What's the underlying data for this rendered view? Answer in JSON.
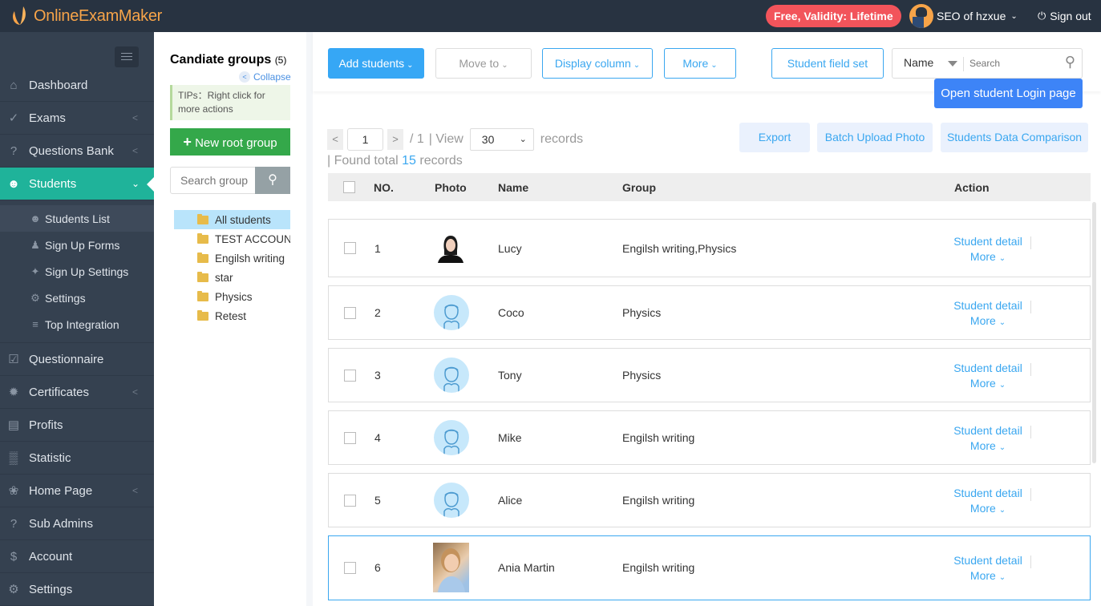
{
  "app": {
    "logo_text": "OnlineExamMaker",
    "validity_badge": "Free, Validity: Lifetime",
    "user_name": "SEO of hzxue",
    "sign_out": "Sign out"
  },
  "sidebar": {
    "items": [
      {
        "label": "Dashboard",
        "icon": "home-icon",
        "has_chevron": false
      },
      {
        "label": "Exams",
        "icon": "check-circle-icon",
        "has_chevron": true
      },
      {
        "label": "Questions Bank",
        "icon": "question-circle-icon",
        "has_chevron": true
      },
      {
        "label": "Students",
        "icon": "users-icon",
        "has_chevron": true,
        "active": true
      },
      {
        "label": "Questionnaire",
        "icon": "checkbox-icon",
        "has_chevron": false
      },
      {
        "label": "Certificates",
        "icon": "certificate-icon",
        "has_chevron": true
      },
      {
        "label": "Profits",
        "icon": "credit-card-icon",
        "has_chevron": false
      },
      {
        "label": "Statistic",
        "icon": "bar-chart-icon",
        "has_chevron": false
      },
      {
        "label": "Home Page",
        "icon": "leaf-icon",
        "has_chevron": true
      },
      {
        "label": "Sub Admins",
        "icon": "question-circle-icon",
        "has_chevron": false
      },
      {
        "label": "Account",
        "icon": "dollar-icon",
        "has_chevron": false
      },
      {
        "label": "Settings",
        "icon": "gear-icon",
        "has_chevron": false
      }
    ],
    "students_submenu": [
      {
        "label": "Students List",
        "icon": "users-icon",
        "active": true
      },
      {
        "label": "Sign Up Forms",
        "icon": "user-plus-icon"
      },
      {
        "label": "Sign Up Settings",
        "icon": "wrench-icon"
      },
      {
        "label": "Settings",
        "icon": "gear-icon"
      },
      {
        "label": "Top Integration",
        "icon": "ordered-list-icon"
      }
    ]
  },
  "groups": {
    "title": "Candiate groups",
    "count": "(5)",
    "collapse": "Collapse",
    "tips": "TIPs：Right click for more actions",
    "new_root_group": "New root group",
    "search_placeholder": "Search group",
    "tree": [
      {
        "label": "All students",
        "active": true
      },
      {
        "label": "TEST ACCOUNT"
      },
      {
        "label": "Engilsh writing"
      },
      {
        "label": "star"
      },
      {
        "label": "Physics"
      },
      {
        "label": "Retest"
      }
    ]
  },
  "toolbar": {
    "add_students": "Add students",
    "move_to": "Move to",
    "display_column": "Display column",
    "more": "More",
    "student_field_set": "Student field set",
    "search_field": "Name",
    "search_placeholder": "Search",
    "open_login": "Open student Login page"
  },
  "pager": {
    "current_page": "1",
    "total_pages": "/ 1",
    "view_label": "| View",
    "per_page": "30",
    "records_label": "records",
    "found_prefix": "|  Found total",
    "found_count": "15",
    "found_suffix": "records"
  },
  "actions": {
    "export": "Export",
    "batch_upload": "Batch Upload Photo",
    "comparison": "Students Data Comparison"
  },
  "table": {
    "headers": {
      "no": "NO.",
      "photo": "Photo",
      "name": "Name",
      "group": "Group",
      "action": "Action"
    },
    "action_detail": "Student detail",
    "action_more": "More",
    "rows": [
      {
        "no": "1",
        "name": "Lucy",
        "group": "Engilsh writing,Physics",
        "photo": "female-portrait"
      },
      {
        "no": "2",
        "name": "Coco",
        "group": "Physics",
        "photo": "default-avatar"
      },
      {
        "no": "3",
        "name": "Tony",
        "group": "Physics",
        "photo": "default-avatar"
      },
      {
        "no": "4",
        "name": "Mike",
        "group": "Engilsh writing",
        "photo": "default-avatar"
      },
      {
        "no": "5",
        "name": "Alice",
        "group": "Engilsh writing",
        "photo": "default-avatar"
      },
      {
        "no": "6",
        "name": "Ania Martin",
        "group": "Engilsh writing",
        "photo": "photo-portrait",
        "selected": true
      }
    ]
  }
}
